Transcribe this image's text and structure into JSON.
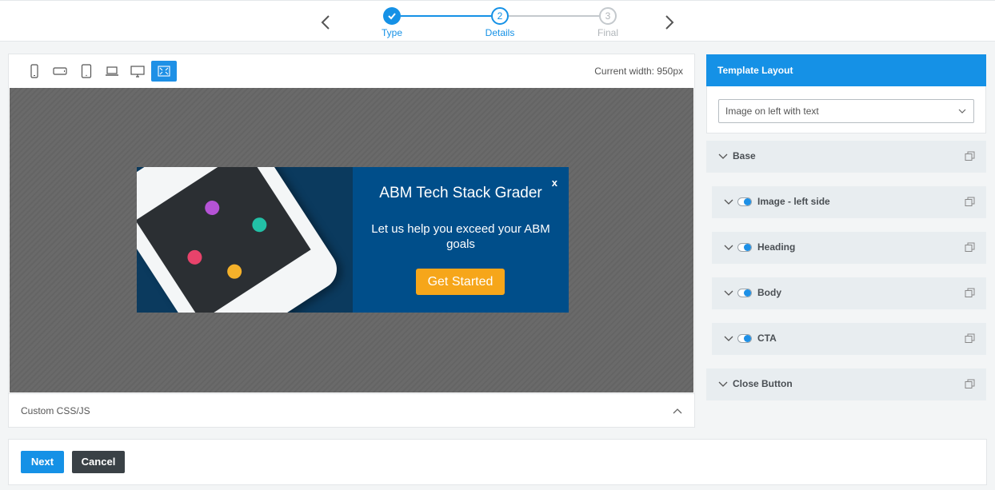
{
  "stepper": {
    "steps": [
      {
        "number": "",
        "label": "Type",
        "state": "done"
      },
      {
        "number": "2",
        "label": "Details",
        "state": "current"
      },
      {
        "number": "3",
        "label": "Final",
        "state": "pending"
      }
    ],
    "colors": {
      "active": "#1591e6",
      "pending": "#c4c9cd"
    }
  },
  "preview": {
    "current_width_label": "Current width: 950px",
    "devices": [
      "phone-portrait-icon",
      "phone-landscape-icon",
      "tablet-icon",
      "laptop-icon",
      "desktop-icon",
      "fullscreen-icon"
    ],
    "active_device": "fullscreen-icon",
    "custom_css_label": "Custom CSS/JS"
  },
  "popup": {
    "title": "ABM Tech Stack Grader",
    "close": "x",
    "body": "Let us help you exceed your ABM goals",
    "cta": "Get Started",
    "colors": {
      "background": "#004e8a",
      "cta": "#f6a61a"
    }
  },
  "template_layout": {
    "heading": "Template Layout",
    "selected": "Image on left with text"
  },
  "sections": [
    {
      "label": "Base",
      "toggle": false,
      "indent": false
    },
    {
      "label": "Image - left side",
      "toggle": true,
      "indent": true
    },
    {
      "label": "Heading",
      "toggle": true,
      "indent": true
    },
    {
      "label": "Body",
      "toggle": true,
      "indent": true
    },
    {
      "label": "CTA",
      "toggle": true,
      "indent": true
    },
    {
      "label": "Close Button",
      "toggle": false,
      "indent": false
    }
  ],
  "footer": {
    "next": "Next",
    "cancel": "Cancel"
  }
}
